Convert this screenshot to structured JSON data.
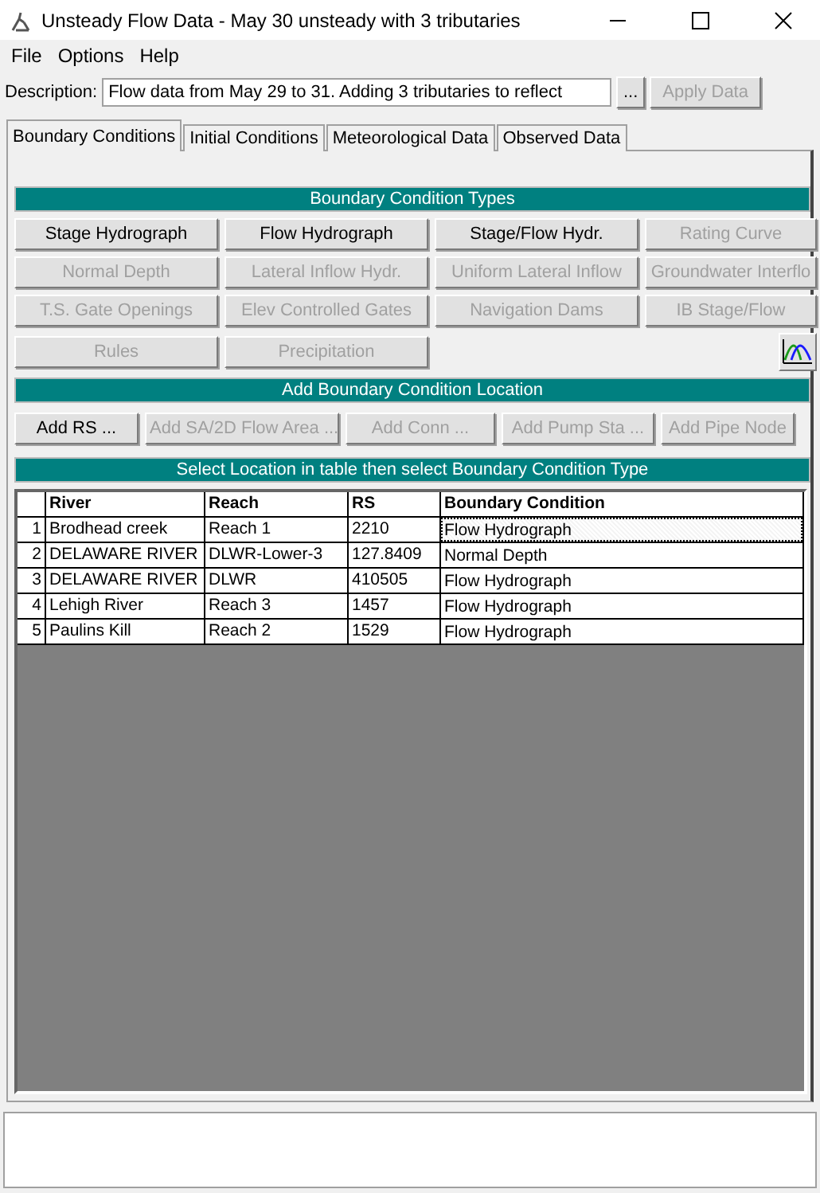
{
  "window": {
    "title": "Unsteady Flow Data - May 30 unsteady with 3 tributaries"
  },
  "menu": [
    "File",
    "Options",
    "Help"
  ],
  "description": {
    "label": "Description:",
    "value": "Flow data from May 29 to 31. Adding 3 tributaries to reflect",
    "browse": "...",
    "apply": {
      "label": "Apply Data",
      "disabled": true
    }
  },
  "tabs": [
    {
      "label": "Boundary Conditions",
      "selected": true
    },
    {
      "label": "Initial Conditions",
      "selected": false
    },
    {
      "label": "Meteorological Data",
      "selected": false
    },
    {
      "label": "Observed Data",
      "selected": false
    }
  ],
  "types": {
    "title": "Boundary Condition Types",
    "buttons": [
      {
        "label": "Stage Hydrograph",
        "disabled": false
      },
      {
        "label": "Flow Hydrograph",
        "disabled": false
      },
      {
        "label": "Stage/Flow Hydr.",
        "disabled": false
      },
      {
        "label": "Rating Curve",
        "disabled": true
      },
      {
        "label": "Normal Depth",
        "disabled": true
      },
      {
        "label": "Lateral Inflow Hydr.",
        "disabled": true
      },
      {
        "label": "Uniform Lateral Inflow",
        "disabled": true
      },
      {
        "label": "Groundwater Interflo",
        "disabled": true
      },
      {
        "label": "T.S. Gate Openings",
        "disabled": true
      },
      {
        "label": "Elev Controlled Gates",
        "disabled": true
      },
      {
        "label": "Navigation Dams",
        "disabled": true
      },
      {
        "label": "IB Stage/Flow",
        "disabled": true
      },
      {
        "label": "Rules",
        "disabled": true
      },
      {
        "label": "Precipitation",
        "disabled": true
      }
    ]
  },
  "locations": {
    "title": "Add Boundary Condition Location",
    "buttons": [
      {
        "label": "Add RS ...",
        "disabled": false
      },
      {
        "label": "Add SA/2D Flow Area ...",
        "disabled": true
      },
      {
        "label": "Add Conn ...",
        "disabled": true
      },
      {
        "label": "Add Pump Sta ...",
        "disabled": true
      },
      {
        "label": "Add Pipe Node",
        "disabled": true
      }
    ]
  },
  "table": {
    "title": "Select Location in table then select Boundary Condition Type",
    "columns": [
      "River",
      "Reach",
      "RS",
      "Boundary Condition"
    ],
    "rows": [
      {
        "number": "1",
        "cells": [
          "Brodhead creek",
          "Reach 1",
          "2210",
          "Flow Hydrograph"
        ],
        "selected": true
      },
      {
        "number": "2",
        "cells": [
          "DELAWARE RIVER",
          "DLWR-Lower-3",
          "127.8409",
          "Normal Depth"
        ],
        "selected": false
      },
      {
        "number": "3",
        "cells": [
          "DELAWARE RIVER",
          "DLWR",
          "410505",
          "Flow Hydrograph"
        ],
        "selected": false
      },
      {
        "number": "4",
        "cells": [
          "Lehigh River",
          "Reach 3",
          "1457",
          "Flow Hydrograph"
        ],
        "selected": false
      },
      {
        "number": "5",
        "cells": [
          "Paulins Kill",
          "Reach 2",
          "1529",
          "Flow Hydrograph"
        ],
        "selected": false
      }
    ]
  }
}
